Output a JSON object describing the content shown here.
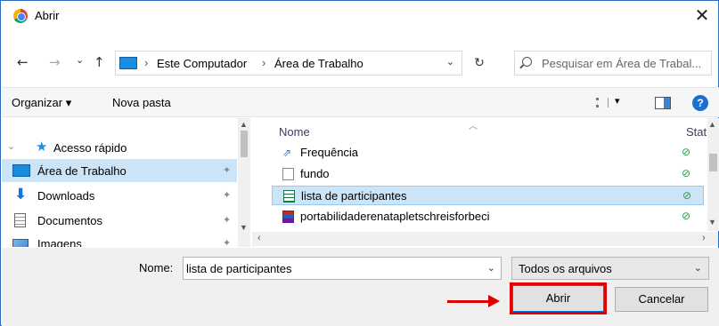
{
  "window": {
    "title": "Abrir",
    "close_symbol": "✕"
  },
  "address": {
    "back": "←",
    "forward": "→",
    "recent": "⌄",
    "up": "↑",
    "separator": "›",
    "crumbs": [
      "Este Computador",
      "Área de Trabalho"
    ],
    "dropdown": "⌄",
    "refresh": "↻"
  },
  "search": {
    "placeholder": "Pesquisar em Área de Trabal..."
  },
  "toolbar": {
    "organize": "Organizar ▾",
    "new_folder": "Nova pasta",
    "view_dropdown": "▾",
    "help": "?"
  },
  "sidebar": {
    "items": [
      {
        "label": "Acesso rápido"
      },
      {
        "label": "Área de Trabalho",
        "pin": "✦"
      },
      {
        "label": "Downloads",
        "pin": "✦"
      },
      {
        "label": "Documentos",
        "pin": "✦"
      },
      {
        "label": "Imagens",
        "pin": "✦"
      }
    ]
  },
  "file_list": {
    "columns": {
      "name": "Nome",
      "status": "Stat"
    },
    "files": [
      {
        "name": "Frequência",
        "status": "⊘"
      },
      {
        "name": "fundo",
        "status": "⊘"
      },
      {
        "name": "lista de participantes",
        "status": "⊘"
      },
      {
        "name": "portabilidaderenatapletschreisforbeci",
        "status": "⊘"
      }
    ]
  },
  "footer": {
    "filename_label": "Nome:",
    "filename_value": "lista de participantes",
    "filetype": "Todos os arquivos",
    "open_label": "Abrir",
    "cancel_label": "Cancelar"
  },
  "colors": {
    "accent": "#0078d7",
    "highlight": "#e00000",
    "selection": "#cce4f7"
  }
}
